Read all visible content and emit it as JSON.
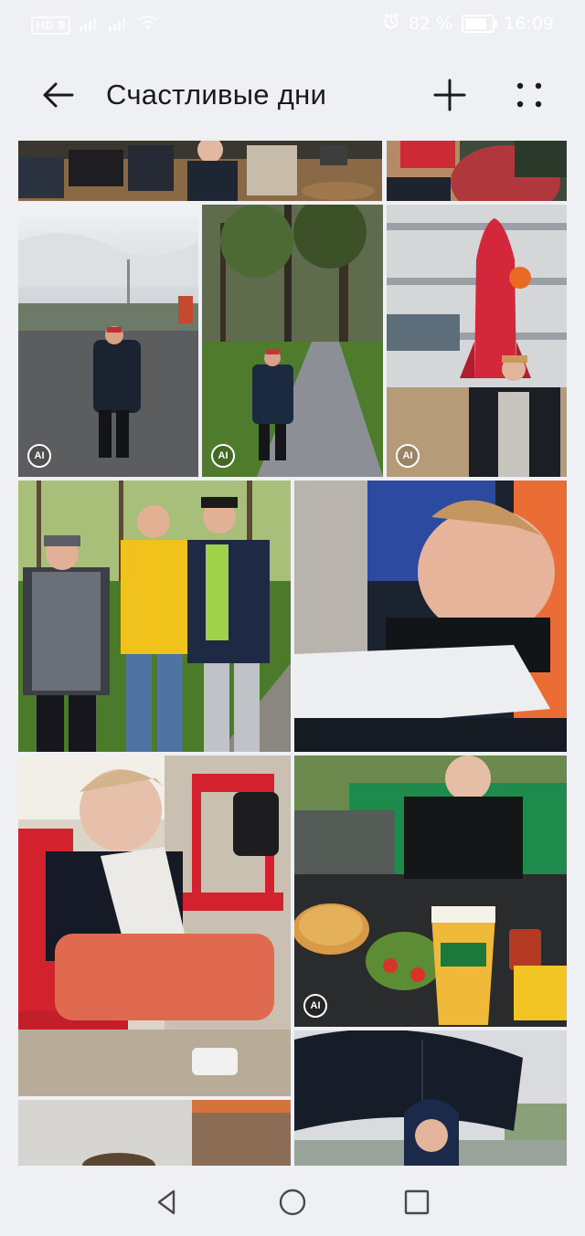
{
  "status_bar": {
    "left_badge": "HD B",
    "battery_text": "82 %",
    "battery_level": 0.82,
    "time": "16:09"
  },
  "header": {
    "title": "Счастливые дни",
    "back_icon": "arrow-left-icon",
    "add_icon": "plus-icon",
    "more_icon": "more-dots-icon"
  },
  "photos": [
    {
      "name": "photo-group-floor",
      "ai": false
    },
    {
      "name": "photo-kid-red-stage",
      "ai": false
    },
    {
      "name": "photo-boy-plaza-tower",
      "ai": true,
      "badge": "AI"
    },
    {
      "name": "photo-boy-park-path",
      "ai": true,
      "badge": "AI"
    },
    {
      "name": "photo-boy-rocket-mall",
      "ai": true,
      "badge": "AI"
    },
    {
      "name": "photo-four-boys-park",
      "ai": false
    },
    {
      "name": "photo-boy-stretcher",
      "ai": false
    },
    {
      "name": "photo-boy-red-chairs",
      "ai": false
    },
    {
      "name": "photo-boy-pizza-table",
      "ai": true,
      "badge": "AI"
    },
    {
      "name": "photo-partial-bottom-left",
      "ai": false
    },
    {
      "name": "photo-boy-umbrella",
      "ai": false
    }
  ],
  "colors": {
    "background": "#eef0f3",
    "text": "#1b1b1b"
  },
  "navbar": {
    "back_icon": "nav-back-triangle-icon",
    "home_icon": "nav-home-circle-icon",
    "recents_icon": "nav-recents-square-icon"
  }
}
